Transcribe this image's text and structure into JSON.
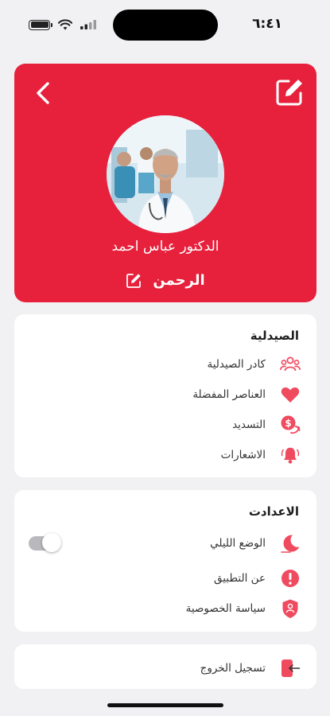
{
  "status_bar": {
    "time": "٦:٤١"
  },
  "profile": {
    "doctor_name": "الدكتور عباس احمد",
    "pharmacy_name": "الرحمن"
  },
  "pharmacy_section": {
    "title": "الصيدلية",
    "items": [
      {
        "label": "كادر الصيدلية",
        "icon": "staff-group-icon"
      },
      {
        "label": "العناصر المفضلة",
        "icon": "heart-icon"
      },
      {
        "label": "التسديد",
        "icon": "payment-icon"
      },
      {
        "label": "الاشعارات",
        "icon": "bell-icon"
      }
    ]
  },
  "settings_section": {
    "title": "الاعدادت",
    "items": [
      {
        "label": "الوضع الليلي",
        "icon": "moon-icon",
        "toggle_on": false
      },
      {
        "label": "عن التطبيق",
        "icon": "info-icon"
      },
      {
        "label": "سياسة الخصوصية",
        "icon": "privacy-shield-icon"
      }
    ]
  },
  "logout": {
    "label": "تسجيل الخروج",
    "icon": "logout-icon"
  },
  "colors": {
    "accent": "#e7203c",
    "icon_fill": "#f04a5f",
    "background": "#f1f1f3"
  }
}
